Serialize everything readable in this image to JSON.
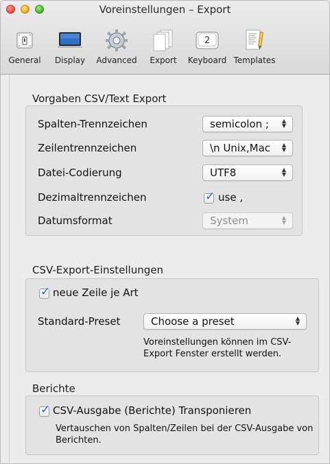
{
  "window": {
    "title": "Voreinstellungen – Export"
  },
  "toolbar": {
    "items": [
      {
        "label": "General",
        "icon": "switch-icon"
      },
      {
        "label": "Display",
        "icon": "monitor-icon"
      },
      {
        "label": "Advanced",
        "icon": "gear-icon"
      },
      {
        "label": "Export",
        "icon": "documents-icon"
      },
      {
        "label": "Keyboard",
        "icon": "key-icon",
        "key": "2"
      },
      {
        "label": "Templates",
        "icon": "template-icon"
      }
    ]
  },
  "csv_defaults": {
    "heading": "Vorgaben CSV/Text Export",
    "column_sep_label": "Spalten-Trennzeichen",
    "column_sep_value": "semicolon ;",
    "line_sep_label": "Zeilentrennzeichen",
    "line_sep_value": "\\n Unix,Mac",
    "encoding_label": "Datei-Codierung",
    "encoding_value": "UTF8",
    "decimal_label": "Dezimaltrennzeichen",
    "decimal_checkbox_label": "use ,",
    "decimal_checked": true,
    "date_label": "Datumsformat",
    "date_value": "System"
  },
  "csv_export": {
    "heading": "CSV-Export-Einstellungen",
    "newline_label": "neue Zeile je Art",
    "newline_checked": true,
    "preset_label": "Standard-Preset",
    "preset_value": "Choose a preset",
    "note": "Voreinstellungen können im CSV-Export Fenster erstellt werden."
  },
  "reports": {
    "heading": "Berichte",
    "transpose_label": "CSV-Ausgabe (Berichte) Transponieren",
    "transpose_checked": true,
    "note": "Vertauschen von Spalten/Zeilen bei der CSV-Ausgabe von Berichten."
  },
  "colors": {
    "checkmark": "#2b62d6",
    "box_bg": "#e3e3e3",
    "window_bg": "#ececec"
  }
}
